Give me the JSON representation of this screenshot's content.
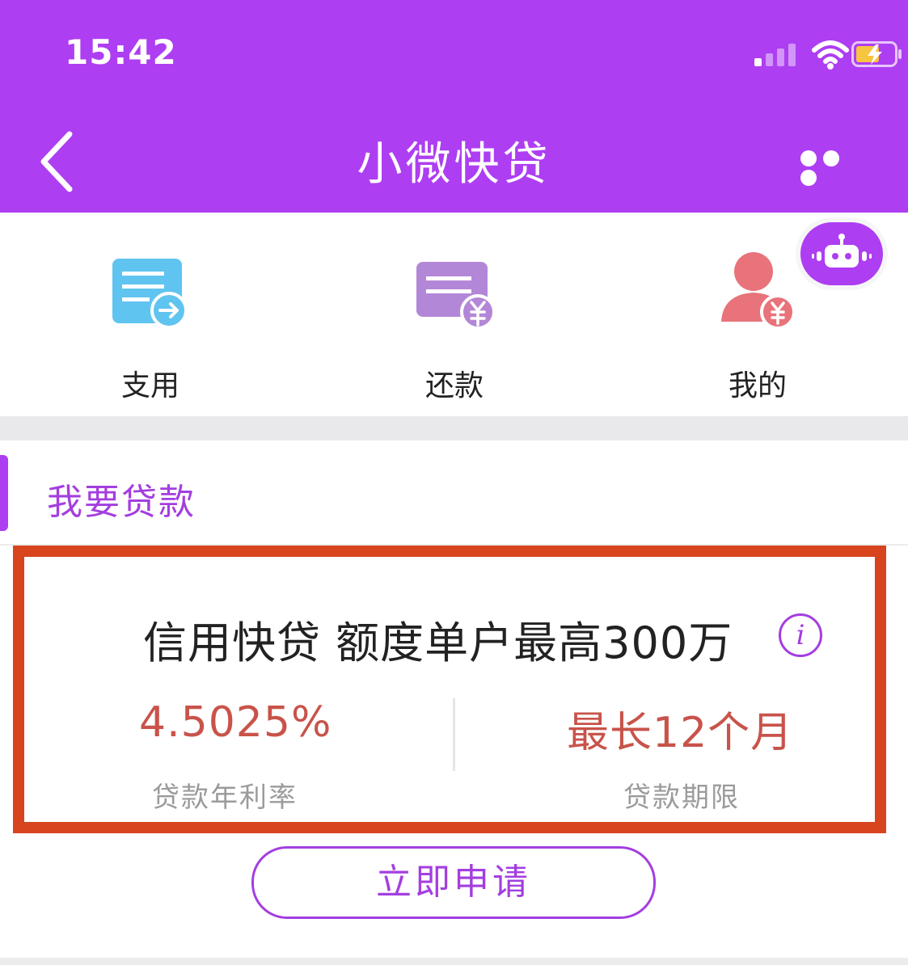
{
  "status_bar": {
    "time": "15:42"
  },
  "nav": {
    "title": "小微快贷"
  },
  "shortcuts": [
    {
      "label": "支用",
      "icon": "document-arrow-icon",
      "color": "#5fc4f0"
    },
    {
      "label": "还款",
      "icon": "card-yen-icon",
      "color": "#b387d7"
    },
    {
      "label": "我的",
      "icon": "user-yen-icon",
      "color": "#e8737a"
    }
  ],
  "section": {
    "title": "我要贷款"
  },
  "loan_card": {
    "headline": "信用快贷 额度单户最高300万",
    "rate_value": "4.5025%",
    "rate_label": "贷款年利率",
    "term_value": "最长12个月",
    "term_label": "贷款期限",
    "info_glyph": "i"
  },
  "apply_button": {
    "label": "立即申请"
  },
  "colors": {
    "brand": "#ae3ef2",
    "accent_text": "#a43ee0",
    "value_red": "#c8534a",
    "highlight_border": "#d7441e"
  }
}
